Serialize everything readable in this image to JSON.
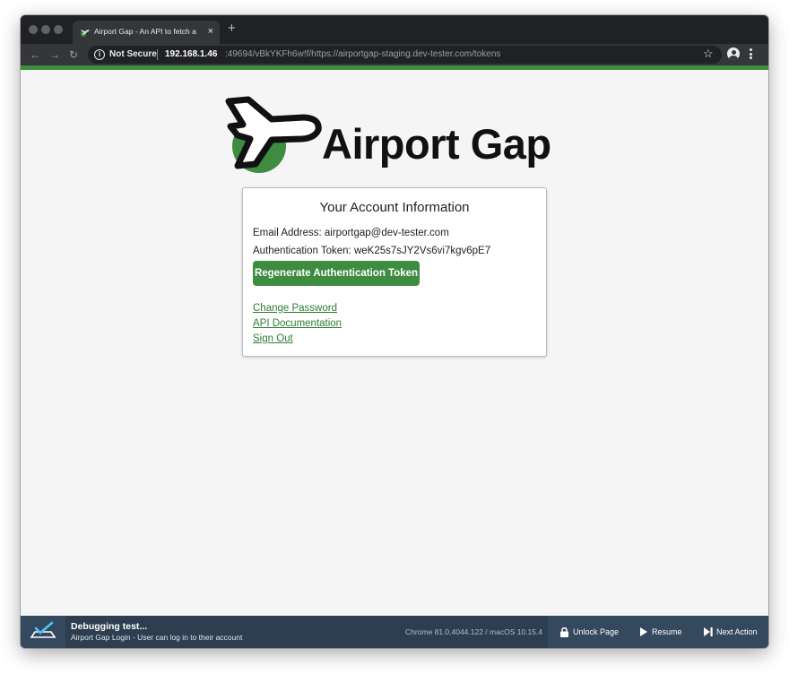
{
  "browser": {
    "tab_title": "Airport Gap - An API to fetch a",
    "tab_close": "×",
    "new_tab": "+",
    "security_label": "Not Secure",
    "url_host": "192.168.1.46",
    "url_rest": ":49694/vBkYKFh6w!f/https://airportgap-staging.dev-tester.com/tokens",
    "icons": [
      "back-icon",
      "forward-icon",
      "reload-icon",
      "info-icon",
      "star-icon",
      "profile-icon",
      "menu-icon"
    ]
  },
  "colors": {
    "brand_green": "#3d8c40",
    "link_green": "#2e7d32",
    "browser_dark": "#202124",
    "debug_bar": "#2c3e50"
  },
  "logo": {
    "text": "Airport Gap"
  },
  "account": {
    "title": "Your Account Information",
    "email_line": "Email Address: airportgap@dev-tester.com",
    "token_line": "Authentication Token: weK25s7sJY2Vs6vi7kgv6pE7",
    "regenerate_button": "Regenerate Authentication Token",
    "links": {
      "change_password": "Change Password",
      "api_docs": "API Documentation",
      "sign_out": "Sign Out"
    }
  },
  "debugger": {
    "title": "Debugging test...",
    "subtitle": "Airport Gap Login - User can log in to their account",
    "environment": "Chrome 81.0.4044.122 / macOS 10.15.4",
    "unlock_label": "Unlock Page",
    "resume_label": "Resume",
    "next_label": "Next Action"
  }
}
